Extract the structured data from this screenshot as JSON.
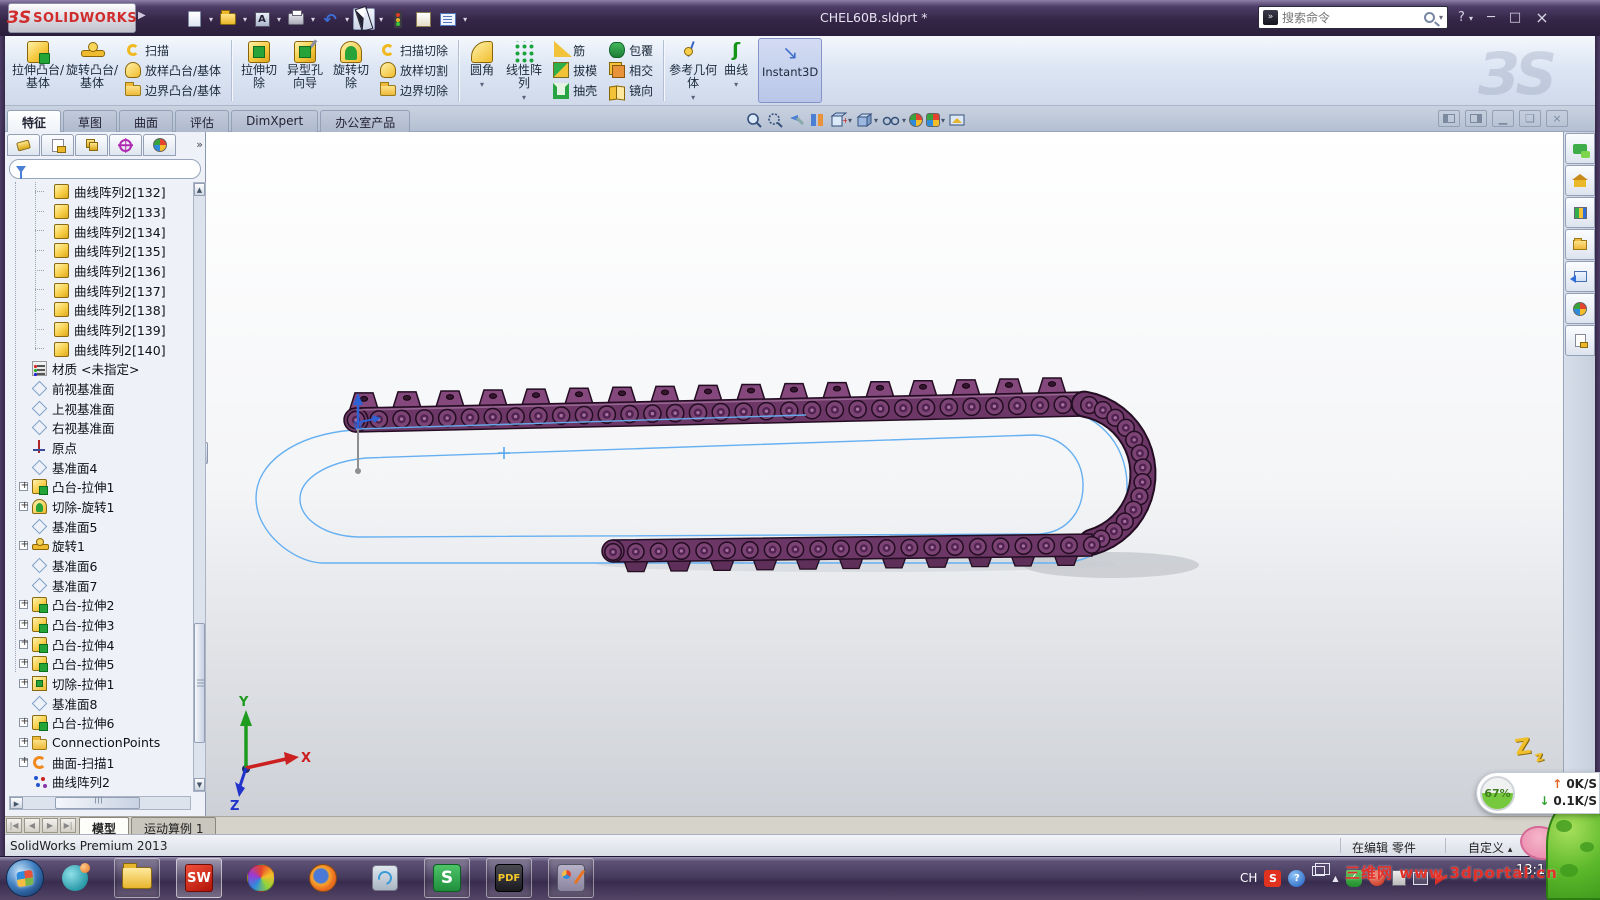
{
  "titlebar": {
    "logo_mark": "ЗS",
    "logo_text": "SOLIDWORKS",
    "document_title": "CHEL60B.sldprt *",
    "search_placeholder": "搜索命令",
    "help_glyph": "?",
    "min_glyph": "─",
    "max_glyph": "□",
    "close_glyph": "×"
  },
  "brand_watermark": "ЗS",
  "ribbon": {
    "extrude_boss": "拉伸凸台/基体",
    "revolve_boss": "旋转凸台/基体",
    "sweep": "扫描",
    "loft": "放样凸台/基体",
    "boundary_boss": "边界凸台/基体",
    "extrude_cut": "拉伸切除",
    "hole_wizard": "异型孔向导",
    "revolve_cut": "旋转切除",
    "sweep_cut": "扫描切除",
    "loft_cut": "放样切割",
    "boundary_cut": "边界切除",
    "fillet": "圆角",
    "linear_pattern": "线性阵列",
    "rib": "筋",
    "draft": "拔模",
    "shell": "抽壳",
    "wrap": "包覆",
    "intersect": "相交",
    "mirror": "镜向",
    "ref_geometry": "参考几何体",
    "curves": "曲线",
    "instant3d": "Instant3D"
  },
  "tabs": [
    "特征",
    "草图",
    "曲面",
    "评估",
    "DimXpert",
    "办公室产品"
  ],
  "fm_more": "»",
  "tree": {
    "items": [
      {
        "label": "曲线阵列2[132]",
        "icon": "cube",
        "cls": "ind"
      },
      {
        "label": "曲线阵列2[133]",
        "icon": "cube",
        "cls": "ind"
      },
      {
        "label": "曲线阵列2[134]",
        "icon": "cube",
        "cls": "ind"
      },
      {
        "label": "曲线阵列2[135]",
        "icon": "cube",
        "cls": "ind"
      },
      {
        "label": "曲线阵列2[136]",
        "icon": "cube",
        "cls": "ind"
      },
      {
        "label": "曲线阵列2[137]",
        "icon": "cube",
        "cls": "ind"
      },
      {
        "label": "曲线阵列2[138]",
        "icon": "cube",
        "cls": "ind"
      },
      {
        "label": "曲线阵列2[139]",
        "icon": "cube",
        "cls": "ind"
      },
      {
        "label": "曲线阵列2[140]",
        "icon": "cube",
        "cls": "ind"
      },
      {
        "label": "材质 <未指定>",
        "icon": "material"
      },
      {
        "label": "前视基准面",
        "icon": "plane"
      },
      {
        "label": "上视基准面",
        "icon": "plane"
      },
      {
        "label": "右视基准面",
        "icon": "plane"
      },
      {
        "label": "原点",
        "icon": "origin"
      },
      {
        "label": "基准面4",
        "icon": "plane"
      },
      {
        "label": "凸台-拉伸1",
        "icon": "boss",
        "exp": true
      },
      {
        "label": "切除-旋转1",
        "icon": "cutrev",
        "exp": true
      },
      {
        "label": "基准面5",
        "icon": "plane"
      },
      {
        "label": "旋转1",
        "icon": "revolve",
        "exp": true
      },
      {
        "label": "基准面6",
        "icon": "plane"
      },
      {
        "label": "基准面7",
        "icon": "plane"
      },
      {
        "label": "凸台-拉伸2",
        "icon": "boss",
        "exp": true
      },
      {
        "label": "凸台-拉伸3",
        "icon": "boss",
        "exp": true
      },
      {
        "label": "凸台-拉伸4",
        "icon": "boss",
        "exp": true
      },
      {
        "label": "凸台-拉伸5",
        "icon": "boss",
        "exp": true
      },
      {
        "label": "切除-拉伸1",
        "icon": "cutex",
        "exp": true
      },
      {
        "label": "基准面8",
        "icon": "plane"
      },
      {
        "label": "凸台-拉伸6",
        "icon": "boss",
        "exp": true
      },
      {
        "label": "ConnectionPoints",
        "icon": "folder",
        "exp": true
      },
      {
        "label": "曲面-扫描1",
        "icon": "surfsweep",
        "exp": true
      },
      {
        "label": "曲线阵列2",
        "icon": "curvepat"
      }
    ]
  },
  "triad": {
    "x": "X",
    "y": "Y",
    "z": "Z"
  },
  "doc_tabs": {
    "model": "模型",
    "motion": "运动算例 1"
  },
  "status": {
    "product": "SolidWorks Premium 2013",
    "editing": "在编辑 零件",
    "customize": "自定义",
    "customize_arrow": "▴",
    "help_glyph": "?"
  },
  "net_widget": {
    "percent": "67%",
    "up_arrow": "↑",
    "up": "0K/S",
    "down_arrow": "↓",
    "down": "0.1K/S",
    "z_big": "Z",
    "z_small": "z"
  },
  "watermark": {
    "text": "三维网 www.3dportal.cn",
    "color": "#e23028"
  },
  "taskbar": {
    "lang": "CH",
    "clock": "13:12",
    "sw_label": "SW",
    "pdf_label": "PDF",
    "green_s_label": "S",
    "sogou_label": "S",
    "help_label": "?",
    "shield_check": "✓"
  }
}
